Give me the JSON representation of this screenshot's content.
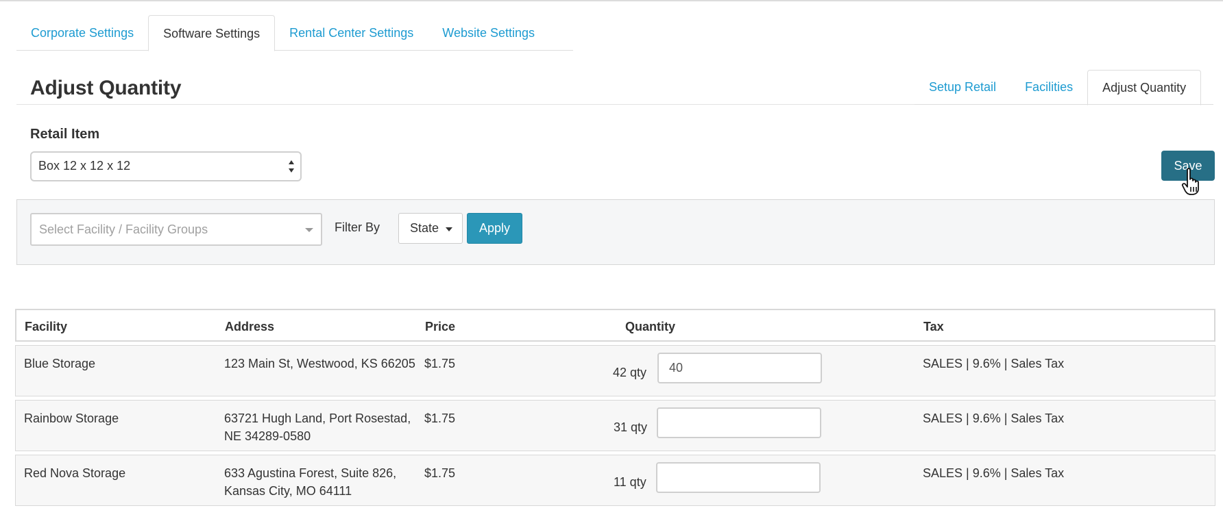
{
  "top_tabs": [
    {
      "label": "Corporate Settings"
    },
    {
      "label": "Software Settings"
    },
    {
      "label": "Rental Center Settings"
    },
    {
      "label": "Website Settings"
    }
  ],
  "page_title": "Adjust Quantity",
  "sub_tabs": [
    {
      "label": "Setup Retail"
    },
    {
      "label": "Facilities"
    },
    {
      "label": "Adjust Quantity"
    }
  ],
  "retail_item": {
    "label": "Retail Item",
    "selected": "Box 12 x 12 x 12"
  },
  "save_label": "Save",
  "filter": {
    "facility_placeholder": "Select Facility / Facility Groups",
    "filter_by_label": "Filter By",
    "state_label": "State",
    "apply_label": "Apply"
  },
  "table": {
    "headers": [
      "Facility",
      "Address",
      "Price",
      "Quantity",
      "Tax"
    ],
    "rows": [
      {
        "facility": "Blue Storage",
        "address": "123 Main St, Westwood, KS 66205",
        "price": "$1.75",
        "qty": "42 qty",
        "input": "40",
        "tax": "SALES | 9.6% | Sales Tax"
      },
      {
        "facility": "Rainbow Storage",
        "address": "63721 Hugh Land, Port Rosestad, NE 34289-0580",
        "price": "$1.75",
        "qty": "31 qty",
        "input": "",
        "tax": "SALES | 9.6% | Sales Tax"
      },
      {
        "facility": "Red Nova Storage",
        "address": "633 Agustina Forest, Suite 826, Kansas City, MO 64111",
        "price": "$1.75",
        "qty": "11 qty",
        "input": "",
        "tax": "SALES | 9.6% | Sales Tax"
      }
    ]
  },
  "colors": {
    "link": "#1d9bd1",
    "save_button": "#276f86",
    "apply_button": "#2b97b8"
  },
  "icons": {
    "cursor": "hand-pointer-icon"
  }
}
